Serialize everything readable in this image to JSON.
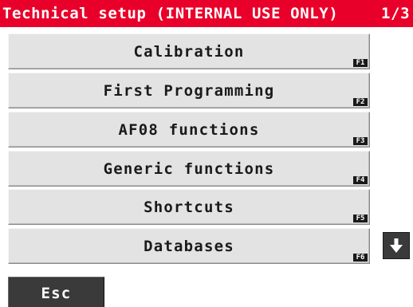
{
  "title_bar": {
    "title": "Technical setup (INTERNAL USE ONLY)",
    "page_indicator": "1/3",
    "background_color": "#e8002a",
    "text_color": "#ffffff"
  },
  "menu": {
    "items": [
      {
        "label": "Calibration",
        "fkey": "F1"
      },
      {
        "label": "First Programming",
        "fkey": "F2"
      },
      {
        "label": "AF08 functions",
        "fkey": "F3"
      },
      {
        "label": "Generic functions",
        "fkey": "F4"
      },
      {
        "label": "Shortcuts",
        "fkey": "F5"
      },
      {
        "label": "Databases",
        "fkey": "F6"
      }
    ],
    "button_color": "#e3e3e3"
  },
  "scroll_down_button": {
    "icon": "arrow-down-icon"
  },
  "esc_button": {
    "label": "Esc",
    "color": "#3a3a3a"
  }
}
